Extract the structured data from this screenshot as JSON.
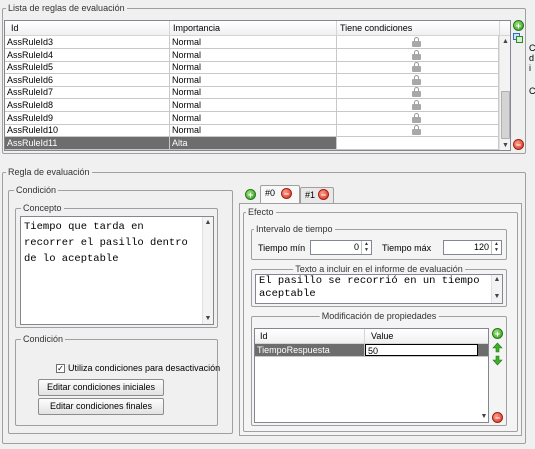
{
  "rules_panel": {
    "title": "Lista de reglas de evaluación",
    "columns": [
      "Id",
      "Importancia",
      "Tiene condiciones"
    ],
    "rows": [
      {
        "id": "AssRuleId3",
        "importance": "Normal",
        "locked": true
      },
      {
        "id": "AssRuleId4",
        "importance": "Normal",
        "locked": true
      },
      {
        "id": "AssRuleId5",
        "importance": "Normal",
        "locked": true
      },
      {
        "id": "AssRuleId6",
        "importance": "Normal",
        "locked": true
      },
      {
        "id": "AssRuleId7",
        "importance": "Normal",
        "locked": true
      },
      {
        "id": "AssRuleId8",
        "importance": "Normal",
        "locked": true
      },
      {
        "id": "AssRuleId9",
        "importance": "Normal",
        "locked": true
      },
      {
        "id": "AssRuleId10",
        "importance": "Normal",
        "locked": true
      },
      {
        "id": "AssRuleId11",
        "importance": "Alta",
        "locked": false,
        "selected": true
      }
    ],
    "side_labels": [
      "C",
      "d",
      "i",
      "C"
    ]
  },
  "rule_panel": {
    "title": "Regla de evaluación",
    "condition_group": {
      "title": "Condición",
      "concept": {
        "title": "Concepto",
        "text": "Tiempo que tarda en\nrecorrer el pasillo dentro\nde lo aceptable"
      },
      "condition": {
        "title": "Condición",
        "checkbox_label": "Utiliza condiciones para desactivación",
        "checked": true,
        "btn_initial": "Editar condiciones iniciales",
        "btn_final": "Editar condiciones finales"
      }
    },
    "tabs": [
      "#0",
      "#1"
    ],
    "effect": {
      "title": "Efecto",
      "interval": {
        "title": "Intervalo de tiempo",
        "min_label": "Tiempo mín",
        "min_value": "0",
        "max_label": "Tiempo máx",
        "max_value": "120"
      },
      "report_text": {
        "title": "Texto a incluir en el informe de evaluación",
        "text": "El pasillo se recorrió en un tiempo\naceptable"
      },
      "properties": {
        "title": "Modificación de propiedades",
        "columns": [
          "Id",
          "Value"
        ],
        "rows": [
          {
            "id": "TiempoRespuesta",
            "value": "50"
          }
        ]
      }
    }
  },
  "colors": {
    "background": "#f0f0f0",
    "selected_row": "#6d6d6d",
    "green_button": "#2e9a1e",
    "red_button": "#d0301e"
  }
}
